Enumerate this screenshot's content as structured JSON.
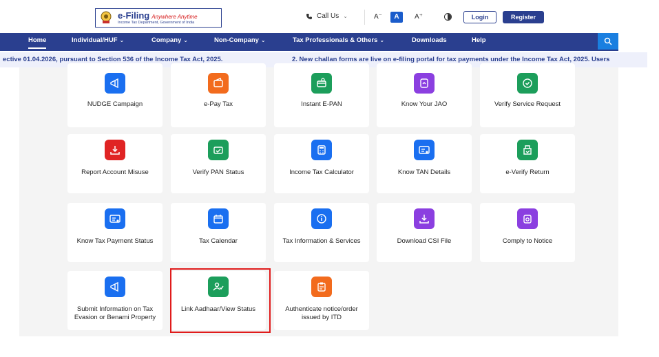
{
  "header": {
    "logo_title": "e-Filing",
    "logo_tagline": "Anywhere Anytime",
    "logo_subtitle": "Income Tax Department, Government of India",
    "call_us": "Call Us",
    "font_small": "A⁻",
    "font_normal": "A",
    "font_large": "A⁺",
    "login": "Login",
    "register": "Register"
  },
  "nav": {
    "items": [
      {
        "label": "Home",
        "dropdown": false
      },
      {
        "label": "Individual/HUF",
        "dropdown": true
      },
      {
        "label": "Company",
        "dropdown": true
      },
      {
        "label": "Non-Company",
        "dropdown": true
      },
      {
        "label": "Tax Professionals & Others",
        "dropdown": true
      },
      {
        "label": "Downloads",
        "dropdown": false
      },
      {
        "label": "Help",
        "dropdown": false
      }
    ]
  },
  "ticker": {
    "item1": "ective 01.04.2026, pursuant to Section 536 of the Income Tax Act, 2025.",
    "item2": "2. New challan forms are live on e-filing portal for tax payments under the Income Tax Act, 2025. Users"
  },
  "services": [
    {
      "label": "NUDGE Campaign",
      "icon": "megaphone-icon",
      "color": "#1a6ff0"
    },
    {
      "label": "e-Pay Tax",
      "icon": "wallet-icon",
      "color": "#f26b1d"
    },
    {
      "label": "Instant E-PAN",
      "icon": "card-icon",
      "color": "#1c9e5b"
    },
    {
      "label": "Know Your JAO",
      "icon": "document-icon",
      "color": "#8b3fe0"
    },
    {
      "label": "Verify Service Request",
      "icon": "chat-check-icon",
      "color": "#1c9e5b"
    },
    {
      "label": "Report Account Misuse",
      "icon": "download-icon",
      "color": "#e02424"
    },
    {
      "label": "Verify PAN Status",
      "icon": "id-check-icon",
      "color": "#1c9e5b"
    },
    {
      "label": "Income Tax Calculator",
      "icon": "calculator-icon",
      "color": "#1a6ff0"
    },
    {
      "label": "Know TAN Details",
      "icon": "id-card-icon",
      "color": "#1a6ff0"
    },
    {
      "label": "e-Verify Return",
      "icon": "verify-doc-icon",
      "color": "#1c9e5b"
    },
    {
      "label": "Know Tax Payment Status",
      "icon": "id-card-icon",
      "color": "#1a6ff0"
    },
    {
      "label": "Tax Calendar",
      "icon": "calendar-icon",
      "color": "#1a6ff0"
    },
    {
      "label": "Tax Information & Services",
      "icon": "info-icon",
      "color": "#1a6ff0"
    },
    {
      "label": "Download CSI File",
      "icon": "download-icon",
      "color": "#8b3fe0"
    },
    {
      "label": "Comply to Notice",
      "icon": "notice-icon",
      "color": "#8b3fe0"
    },
    {
      "label": "Submit Information on Tax Evasion or Benami Property",
      "icon": "megaphone-icon",
      "color": "#1a6ff0"
    },
    {
      "label": "Link Aadhaar/View Status",
      "icon": "user-check-icon",
      "color": "#1c9e5b"
    },
    {
      "label": "Authenticate notice/order issued by ITD",
      "icon": "clipboard-icon",
      "color": "#f26b1d"
    }
  ]
}
